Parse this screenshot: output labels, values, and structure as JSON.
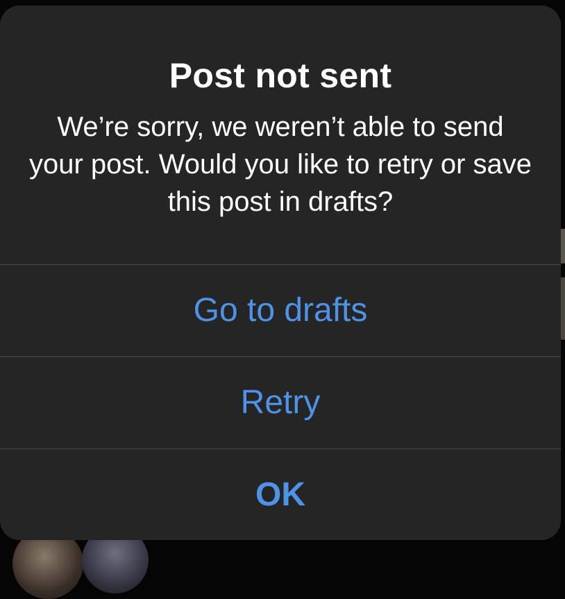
{
  "alert": {
    "title": "Post not sent",
    "message": "We’re sorry, we weren’t able to send your post. Would you like to retry or save this post in drafts?",
    "buttons": {
      "go_to_drafts": "Go to drafts",
      "retry": "Retry",
      "ok": "OK"
    }
  },
  "colors": {
    "alert_background": "#252525",
    "button_text": "#4f93e8",
    "separator": "#4a4a4d",
    "title_text": "#ffffff"
  }
}
